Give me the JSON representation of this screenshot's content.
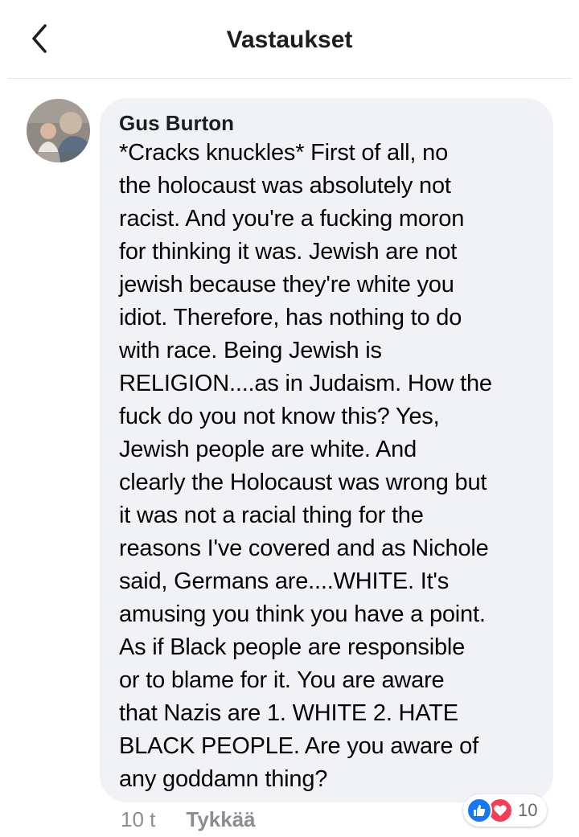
{
  "header": {
    "title": "Vastaukset",
    "back_icon": "chevron-left-icon"
  },
  "comment": {
    "author": "Gus Burton",
    "text": "*Cracks knuckles*  First of all, no\nthe holocaust was absolutely not\nracist.  And you're a fucking moron\nfor thinking it was.  Jewish are not\njewish because they're white you\nidiot.  Therefore, has nothing to do\nwith race.  Being Jewish is\nRELIGION....as in Judaism.  How the\nfuck do you not know this?  Yes,\nJewish people are white.  And\nclearly the Holocaust was wrong but\nit was not a racial thing for the\nreasons I've covered and as Nichole\nsaid, Germans are....WHITE.   It's\namusing you think you have a point.\nAs if Black people are responsible\nor to blame for it.  You are aware\nthat Nazis are 1. WHITE 2. HATE\nBLACK PEOPLE.   Are you aware of\nany goddamn thing?",
    "time": "10 t",
    "like_label": "Tykkää",
    "reactions": {
      "icons": [
        "thumbs-up-icon",
        "heart-icon"
      ],
      "count": "10"
    }
  },
  "colors": {
    "bubble": "#f0f2f5",
    "meta": "#8a8d91",
    "like_blue": "#1877f2",
    "love_red": "#f33e58"
  }
}
